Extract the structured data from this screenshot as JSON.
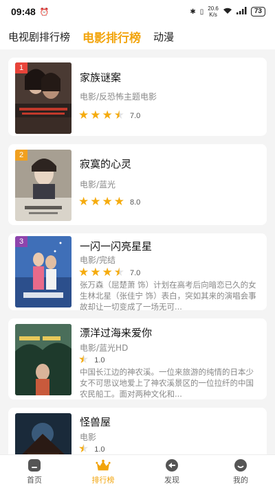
{
  "status": {
    "time": "09:48",
    "speed_top": "20.6",
    "speed_bottom": "K/s",
    "battery": "73"
  },
  "tabs": [
    {
      "label": "电视剧排行榜",
      "active": false
    },
    {
      "label": "电影排行榜",
      "active": true
    },
    {
      "label": "动漫",
      "active": false
    }
  ],
  "movies": [
    {
      "rank": "1",
      "title": "家族谜案",
      "genre": "电影/反恐怖主题电影",
      "score": "7.0",
      "desc": ""
    },
    {
      "rank": "2",
      "title": "寂寞的心灵",
      "genre": "电影/蓝光",
      "score": "8.0",
      "desc": ""
    },
    {
      "rank": "3",
      "title": "一闪一闪亮星星",
      "genre": "电影/完结",
      "score": "7.0",
      "desc": "张万森（屈楚萧 饰）计划在高考后向暗恋已久的女生林北星（张佳宁 饰）表白，突如其来的演唱会事故却让一切变成了一场无可..."
    },
    {
      "rank": "",
      "title": "漂洋过海来爱你",
      "genre": "电影/蓝光HD",
      "score": "1.0",
      "desc": "中国长江边的神农溪。一位来旅游的纯情的日本少女不可思议地爱上了神农溪景区的一位拉纤的中国农民船工。面对两种文化和..."
    },
    {
      "rank": "",
      "title": "怪兽屋",
      "genre": "电影",
      "score": "1.0",
      "desc": ""
    }
  ],
  "nav": [
    {
      "label": "首页",
      "active": false
    },
    {
      "label": "排行榜",
      "active": true
    },
    {
      "label": "发现",
      "active": false
    },
    {
      "label": "我的",
      "active": false
    }
  ],
  "colors": {
    "accent": "#f2a40c",
    "rank1": "#e8443a",
    "rank2": "#f0a020",
    "rank3": "#8e44ad"
  }
}
